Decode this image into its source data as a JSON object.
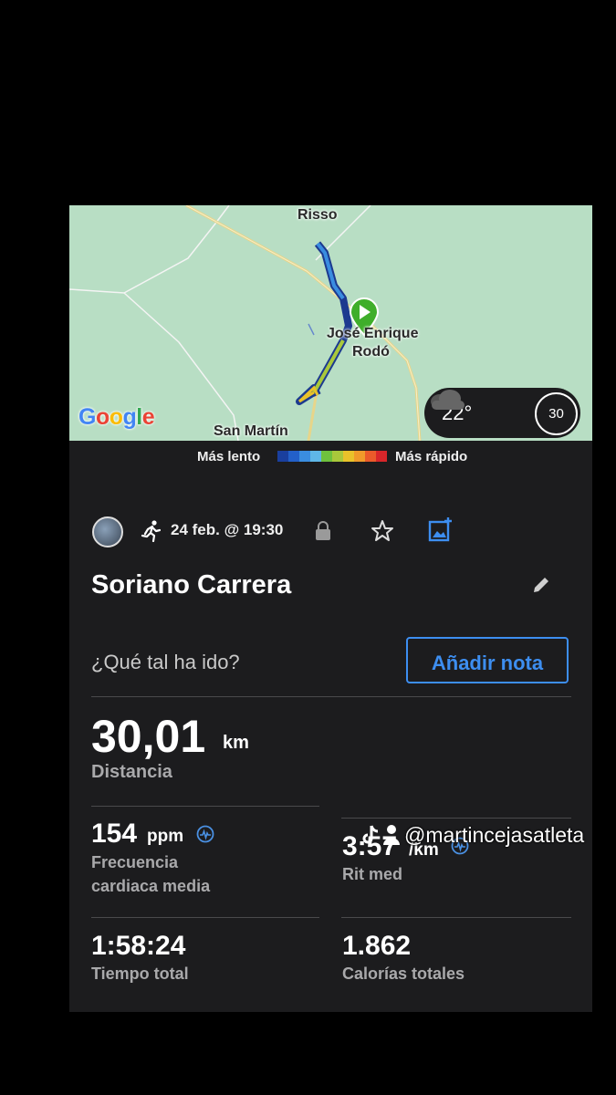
{
  "map": {
    "labels": {
      "risso": "Risso",
      "place_line1": "José Enrique",
      "place_line2": "Rodó",
      "san_martin": "San Martín"
    },
    "google_logo": {
      "G": "G",
      "o1": "o",
      "o2": "o",
      "g": "g",
      "l": "l",
      "e": "e"
    },
    "weather": {
      "temperature": "22°",
      "icon": "cloud-icon",
      "wind_speed": "30"
    }
  },
  "legend": {
    "slower": "Más lento",
    "faster": "Más rápido",
    "colors": [
      "#1a3f9e",
      "#2360c9",
      "#3a8de0",
      "#5fb7e8",
      "#6fc13d",
      "#a9c83b",
      "#e9c22a",
      "#f09a2a",
      "#ea5a2a",
      "#d8262a"
    ]
  },
  "activity": {
    "type_icon": "running-icon",
    "date": "24 feb. @ 19:30",
    "title": "Soriano Carrera",
    "question": "¿Qué tal ha ido?",
    "add_note": "Añadir nota"
  },
  "stats": {
    "distance": {
      "value": "30,01",
      "unit": "km",
      "label": "Distancia"
    },
    "heart_rate": {
      "value": "154",
      "unit": "ppm",
      "label_line1": "Frecuencia",
      "label_line2": "cardiaca media"
    },
    "pace": {
      "value": "3:57",
      "unit": "/km",
      "label": "Rit med"
    },
    "time": {
      "value": "1:58:24",
      "label": "Tiempo total"
    },
    "calories": {
      "value": "1.862",
      "label": "Calorías totales"
    }
  },
  "watermark": "@martincejasatleta",
  "accent_color": "#3d8ef0"
}
